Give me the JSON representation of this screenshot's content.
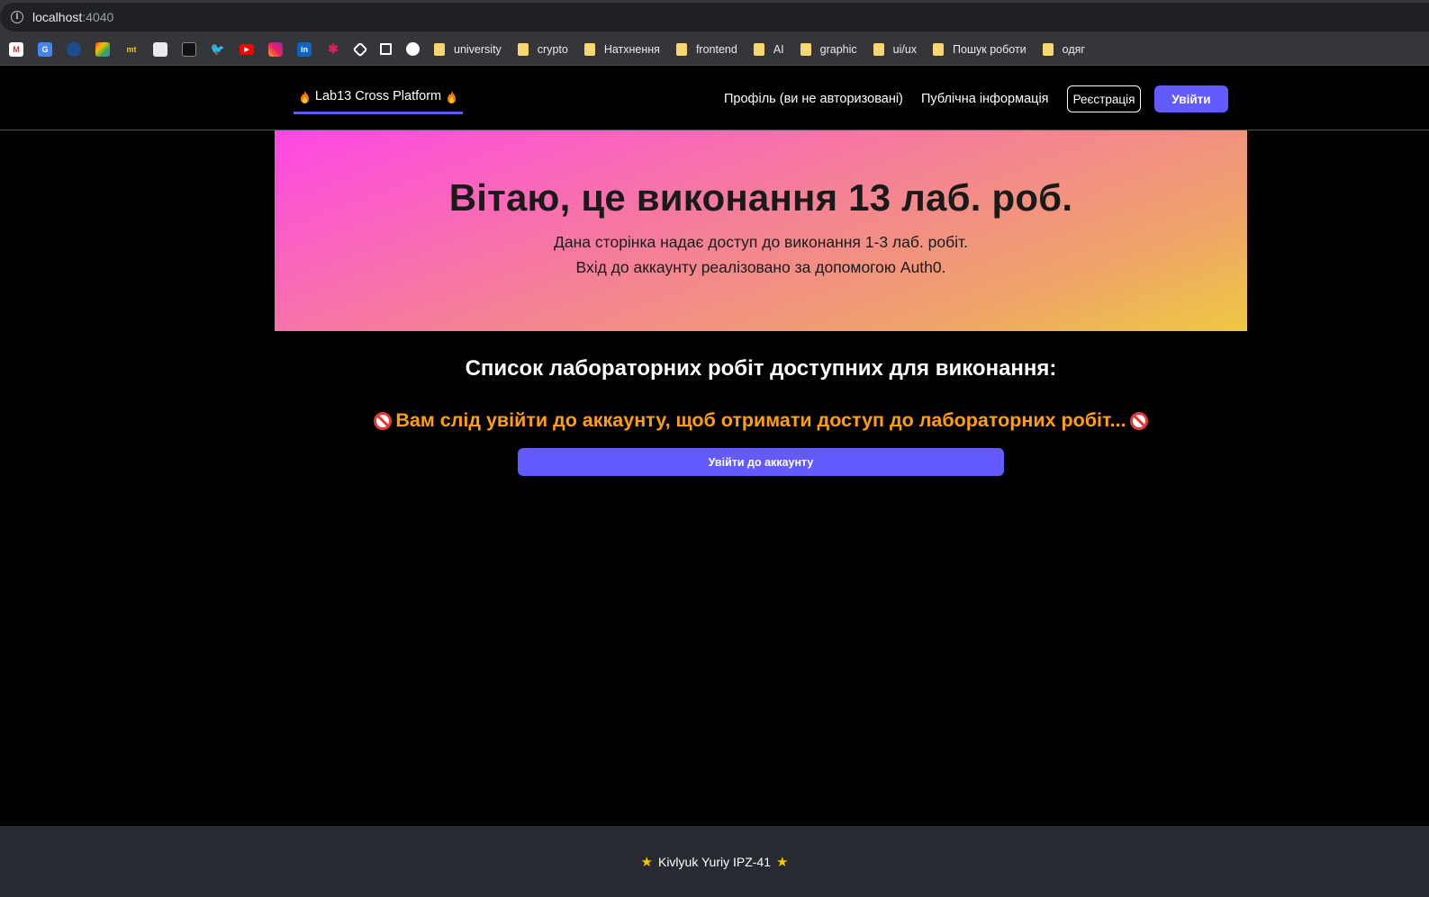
{
  "browser": {
    "url_host": "localhost",
    "url_port": ":4040",
    "bookmark_icons": [
      "gmail-icon",
      "google-translate-icon",
      "cube-icon",
      "photos-icon",
      "mt-icon",
      "doc-icon",
      "terminal-icon",
      "twitter-icon",
      "youtube-icon",
      "instagram-icon",
      "linkedin-icon",
      "slack-icon",
      "codepen-icon",
      "square-icon",
      "github-icon"
    ],
    "mt_label": "mt",
    "in_label": "in",
    "folders": [
      "university",
      "crypto",
      "Натхнення",
      "frontend",
      "AI",
      "graphic",
      "ui/ux",
      "Пошук роботи",
      "одяг"
    ]
  },
  "nav": {
    "brand": "Lab13 Cross Platform",
    "profile_link": "Профіль (ви не авторизовані)",
    "public_link": "Публічна інформація",
    "register_label": "Реєстрація",
    "login_label": "Увійти"
  },
  "hero": {
    "title": "Вітаю, це виконання 13 лаб. роб.",
    "line1": "Дана сторінка надає доступ до виконання 1-3 лаб. робіт.",
    "line2": "Вхід до аккаунту реалізовано за допомогою Auth0."
  },
  "main": {
    "section_title": "Список лабораторних робіт доступних для виконання:",
    "warning": "Вам слід увійти до аккаунту, щоб отримати доступ до лабораторних робіт...",
    "cta_label": "Увійти до аккаунту"
  },
  "footer": {
    "text": "Kivlyuk Yuriy IPZ-41"
  },
  "colors": {
    "accent": "#635bff",
    "warning": "#ff9f0e",
    "footer_bg": "#272a31"
  }
}
